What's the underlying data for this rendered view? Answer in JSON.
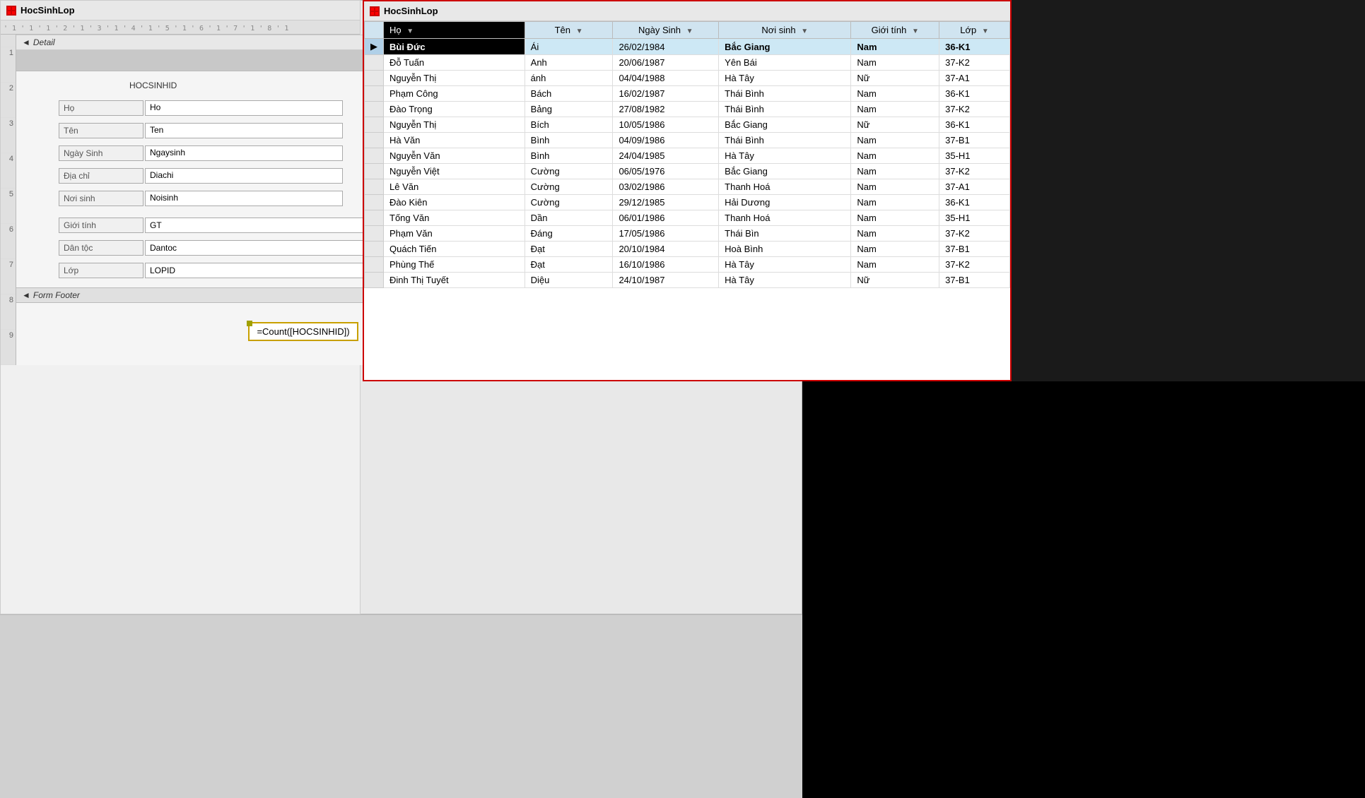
{
  "leftPanel": {
    "title": "HocSinhLop",
    "ruler": "' 1 ' 1 ' 1 ' 2 ' 1 ' 3 ' 1 ' 4 ' 1 ' 5 ' 1 ' 6 ' 1 ' 7 ' 1 ' 8 ' 1",
    "sections": {
      "detail": "Detail",
      "formFooter": "Form Footer"
    },
    "fields": [
      {
        "label": "Họ",
        "value": "Ho"
      },
      {
        "label": "Tên",
        "value": "Ten"
      },
      {
        "label": "Ngày Sinh",
        "value": "Ngaysinh"
      },
      {
        "label": "Địa chỉ",
        "value": "Diachi"
      },
      {
        "label": "Nơi sinh",
        "value": "Noisinh"
      },
      {
        "label": "Giới tính",
        "value": "GT",
        "type": "dropdown"
      },
      {
        "label": "Dân tộc",
        "value": "Dantoc"
      },
      {
        "label": "Lớp",
        "value": "LOPID",
        "type": "dropdown"
      }
    ],
    "hocsinhid": "HOCSINHID",
    "countFormula": "=Count([HOCSINHID])"
  },
  "rightPanel": {
    "title": "HocSinhLop",
    "columns": [
      {
        "label": "Họ",
        "key": "ho"
      },
      {
        "label": "Tên",
        "key": "ten"
      },
      {
        "label": "Ngày Sinh",
        "key": "ngaysinh"
      },
      {
        "label": "Nơi sinh",
        "key": "noisinh"
      },
      {
        "label": "Giới tính",
        "key": "gioitinh"
      },
      {
        "label": "Lớp",
        "key": "lop"
      }
    ],
    "rows": [
      {
        "ho": "Bùi Đức",
        "ten": "Ái",
        "ngaysinh": "26/02/1984",
        "noisinh": "Bắc Giang",
        "gioitinh": "Nam",
        "lop": "36-K1",
        "selected": true
      },
      {
        "ho": "Đỗ Tuấn",
        "ten": "Anh",
        "ngaysinh": "20/06/1987",
        "noisinh": "Yên Bái",
        "gioitinh": "Nam",
        "lop": "37-K2",
        "selected": false
      },
      {
        "ho": "Nguyễn Thị",
        "ten": "ánh",
        "ngaysinh": "04/04/1988",
        "noisinh": "Hà Tây",
        "gioitinh": "Nữ",
        "lop": "37-A1",
        "selected": false
      },
      {
        "ho": "Phạm Công",
        "ten": "Bách",
        "ngaysinh": "16/02/1987",
        "noisinh": "Thái Bình",
        "gioitinh": "Nam",
        "lop": "36-K1",
        "selected": false
      },
      {
        "ho": "Đào Trọng",
        "ten": "Bảng",
        "ngaysinh": "27/08/1982",
        "noisinh": "Thái Bình",
        "gioitinh": "Nam",
        "lop": "37-K2",
        "selected": false
      },
      {
        "ho": "Nguyễn Thị",
        "ten": "Bích",
        "ngaysinh": "10/05/1986",
        "noisinh": "Bắc Giang",
        "gioitinh": "Nữ",
        "lop": "36-K1",
        "selected": false
      },
      {
        "ho": "Hà Văn",
        "ten": "Bình",
        "ngaysinh": "04/09/1986",
        "noisinh": "Thái Bình",
        "gioitinh": "Nam",
        "lop": "37-B1",
        "selected": false
      },
      {
        "ho": "Nguyễn Văn",
        "ten": "Bình",
        "ngaysinh": "24/04/1985",
        "noisinh": "Hà Tây",
        "gioitinh": "Nam",
        "lop": "35-H1",
        "selected": false
      },
      {
        "ho": "Nguyễn Việt",
        "ten": "Cường",
        "ngaysinh": "06/05/1976",
        "noisinh": "Bắc Giang",
        "gioitinh": "Nam",
        "lop": "37-K2",
        "selected": false
      },
      {
        "ho": "Lê Văn",
        "ten": "Cường",
        "ngaysinh": "03/02/1986",
        "noisinh": "Thanh Hoá",
        "gioitinh": "Nam",
        "lop": "37-A1",
        "selected": false
      },
      {
        "ho": "Đào Kiên",
        "ten": "Cường",
        "ngaysinh": "29/12/1985",
        "noisinh": "Hải Dương",
        "gioitinh": "Nam",
        "lop": "36-K1",
        "selected": false
      },
      {
        "ho": "Tống Văn",
        "ten": "Dần",
        "ngaysinh": "06/01/1986",
        "noisinh": "Thanh Hoá",
        "gioitinh": "Nam",
        "lop": "35-H1",
        "selected": false
      },
      {
        "ho": "Phạm Văn",
        "ten": "Đáng",
        "ngaysinh": "17/05/1986",
        "noisinh": "Thái Bìn",
        "gioitinh": "Nam",
        "lop": "37-K2",
        "selected": false
      },
      {
        "ho": "Quách Tiến",
        "ten": "Đạt",
        "ngaysinh": "20/10/1984",
        "noisinh": "Hoà Bình",
        "gioitinh": "Nam",
        "lop": "37-B1",
        "selected": false
      },
      {
        "ho": "Phùng Thế",
        "ten": "Đạt",
        "ngaysinh": "16/10/1986",
        "noisinh": "Hà Tây",
        "gioitinh": "Nam",
        "lop": "37-K2",
        "selected": false
      },
      {
        "ho": "Đinh Thị Tuyết",
        "ten": "Diệu",
        "ngaysinh": "24/10/1987",
        "noisinh": "Hà Tây",
        "gioitinh": "Nữ",
        "lop": "37-B1",
        "selected": false
      }
    ]
  }
}
